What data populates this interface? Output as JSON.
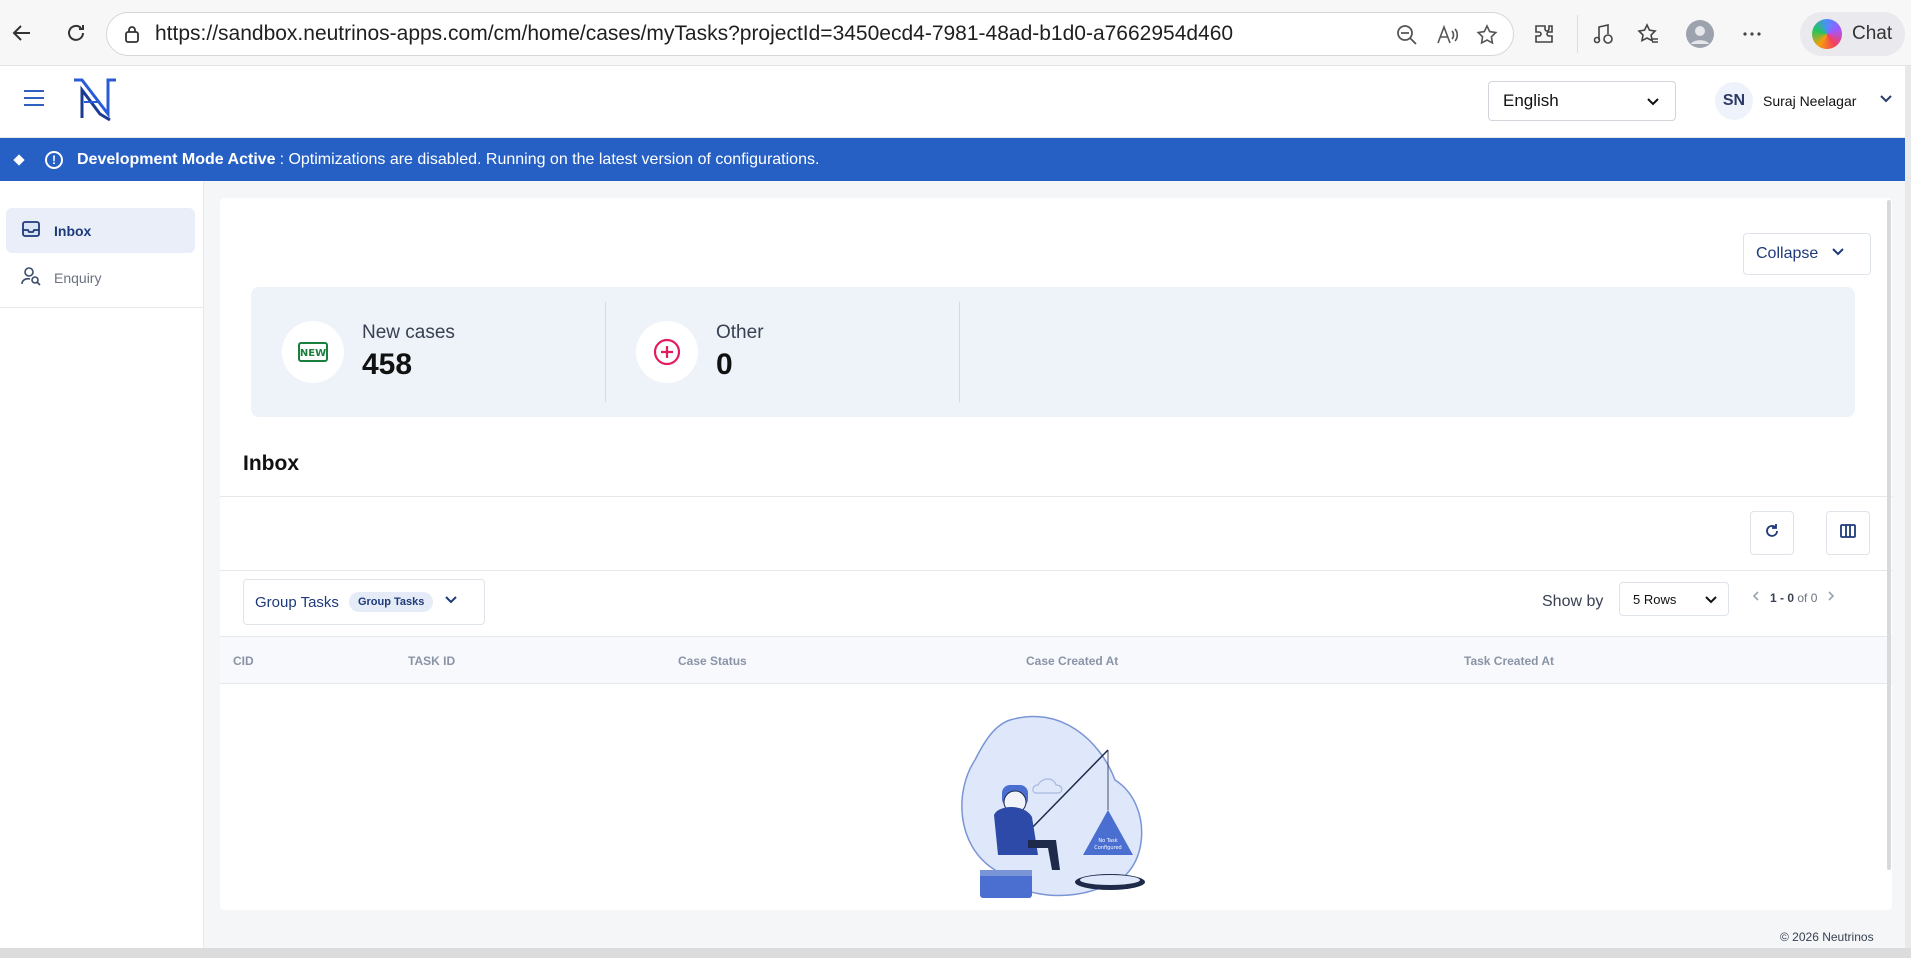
{
  "browser": {
    "url": "https://sandbox.neutrinos-apps.com/cm/home/cases/myTasks?projectId=3450ecd4-7981-48ad-b1d0-a7662954d460",
    "chat_label": "Chat"
  },
  "header": {
    "language": "English",
    "user_initials": "SN",
    "user_name": "Suraj Neelagar"
  },
  "banner": {
    "title": "Development Mode Active",
    "message": ": Optimizations are disabled. Running on the latest version of configurations."
  },
  "sidebar": {
    "items": [
      {
        "label": "Inbox",
        "icon": "inbox-icon",
        "active": true
      },
      {
        "label": "Enquiry",
        "icon": "user-search-icon",
        "active": false
      }
    ]
  },
  "main": {
    "collapse_label": "Collapse",
    "stats": [
      {
        "label": "New cases",
        "value": "458",
        "icon": "new-badge-icon"
      },
      {
        "label": "Other",
        "value": "0",
        "icon": "plus-circle-icon"
      }
    ],
    "section_title": "Inbox",
    "group_select": {
      "label": "Group Tasks",
      "pill": "Group Tasks"
    },
    "show_by_label": "Show by",
    "rows_value": "5 Rows",
    "pager": {
      "range": "1 - 0",
      "of": "of 0"
    },
    "columns": [
      "CID",
      "TASK ID",
      "Case Status",
      "Case Created At",
      "Task Created At"
    ],
    "empty_text": "No Task Configured"
  },
  "footer": {
    "copyright": "© 2026 Neutrinos"
  },
  "colors": {
    "accent": "#2660c4",
    "brand": "#1e3a7b",
    "new_badge": "#1a7f3c",
    "other_icon": "#e11d5c"
  }
}
